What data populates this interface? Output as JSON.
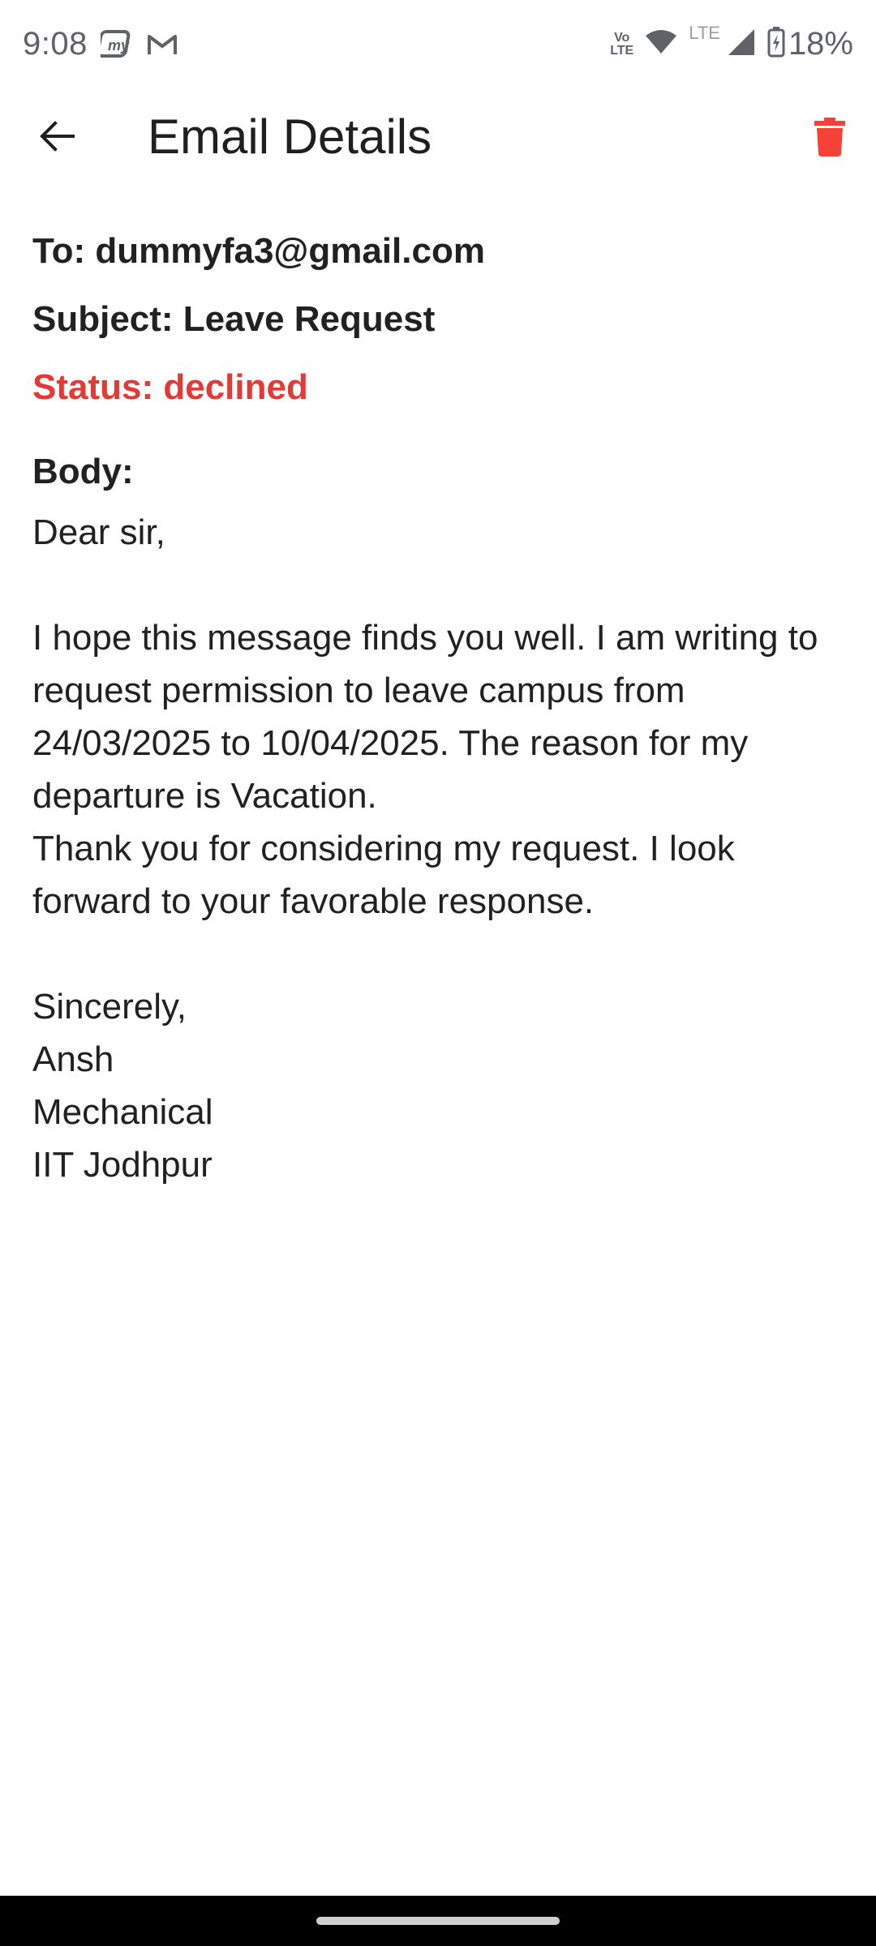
{
  "status_bar": {
    "time": "9:08",
    "left_icons": [
      "myjio-icon",
      "gmail-icon"
    ],
    "volte_top": "Vo",
    "volte_bottom": "LTE",
    "lte_label": "LTE",
    "battery_percent": "18%",
    "right_icons": [
      "volte-icon",
      "wifi-icon",
      "signal-icon",
      "battery-charging-icon"
    ]
  },
  "app_bar": {
    "title": "Email Details",
    "back_icon": "arrow-back-icon",
    "delete_icon": "trash-icon"
  },
  "email": {
    "to_line": "To: dummyfa3@gmail.com",
    "subject_line": "Subject: Leave Request",
    "status_line": "Status: declined",
    "body_label": "Body:",
    "body_text": "Dear sir,\n\nI hope this message finds you well. I am writing to request permission to leave campus from 24/03/2025 to 10/04/2025. The reason for my departure is Vacation.\nThank you for considering my request. I look forward to your favorable response.\n\nSincerely,\nAnsh\nMechanical\nIIT Jodhpur"
  },
  "colors": {
    "accent_red": "#e53935",
    "text_primary": "#212121",
    "status_icons": "#5f6368",
    "nav_bar": "#000000"
  }
}
